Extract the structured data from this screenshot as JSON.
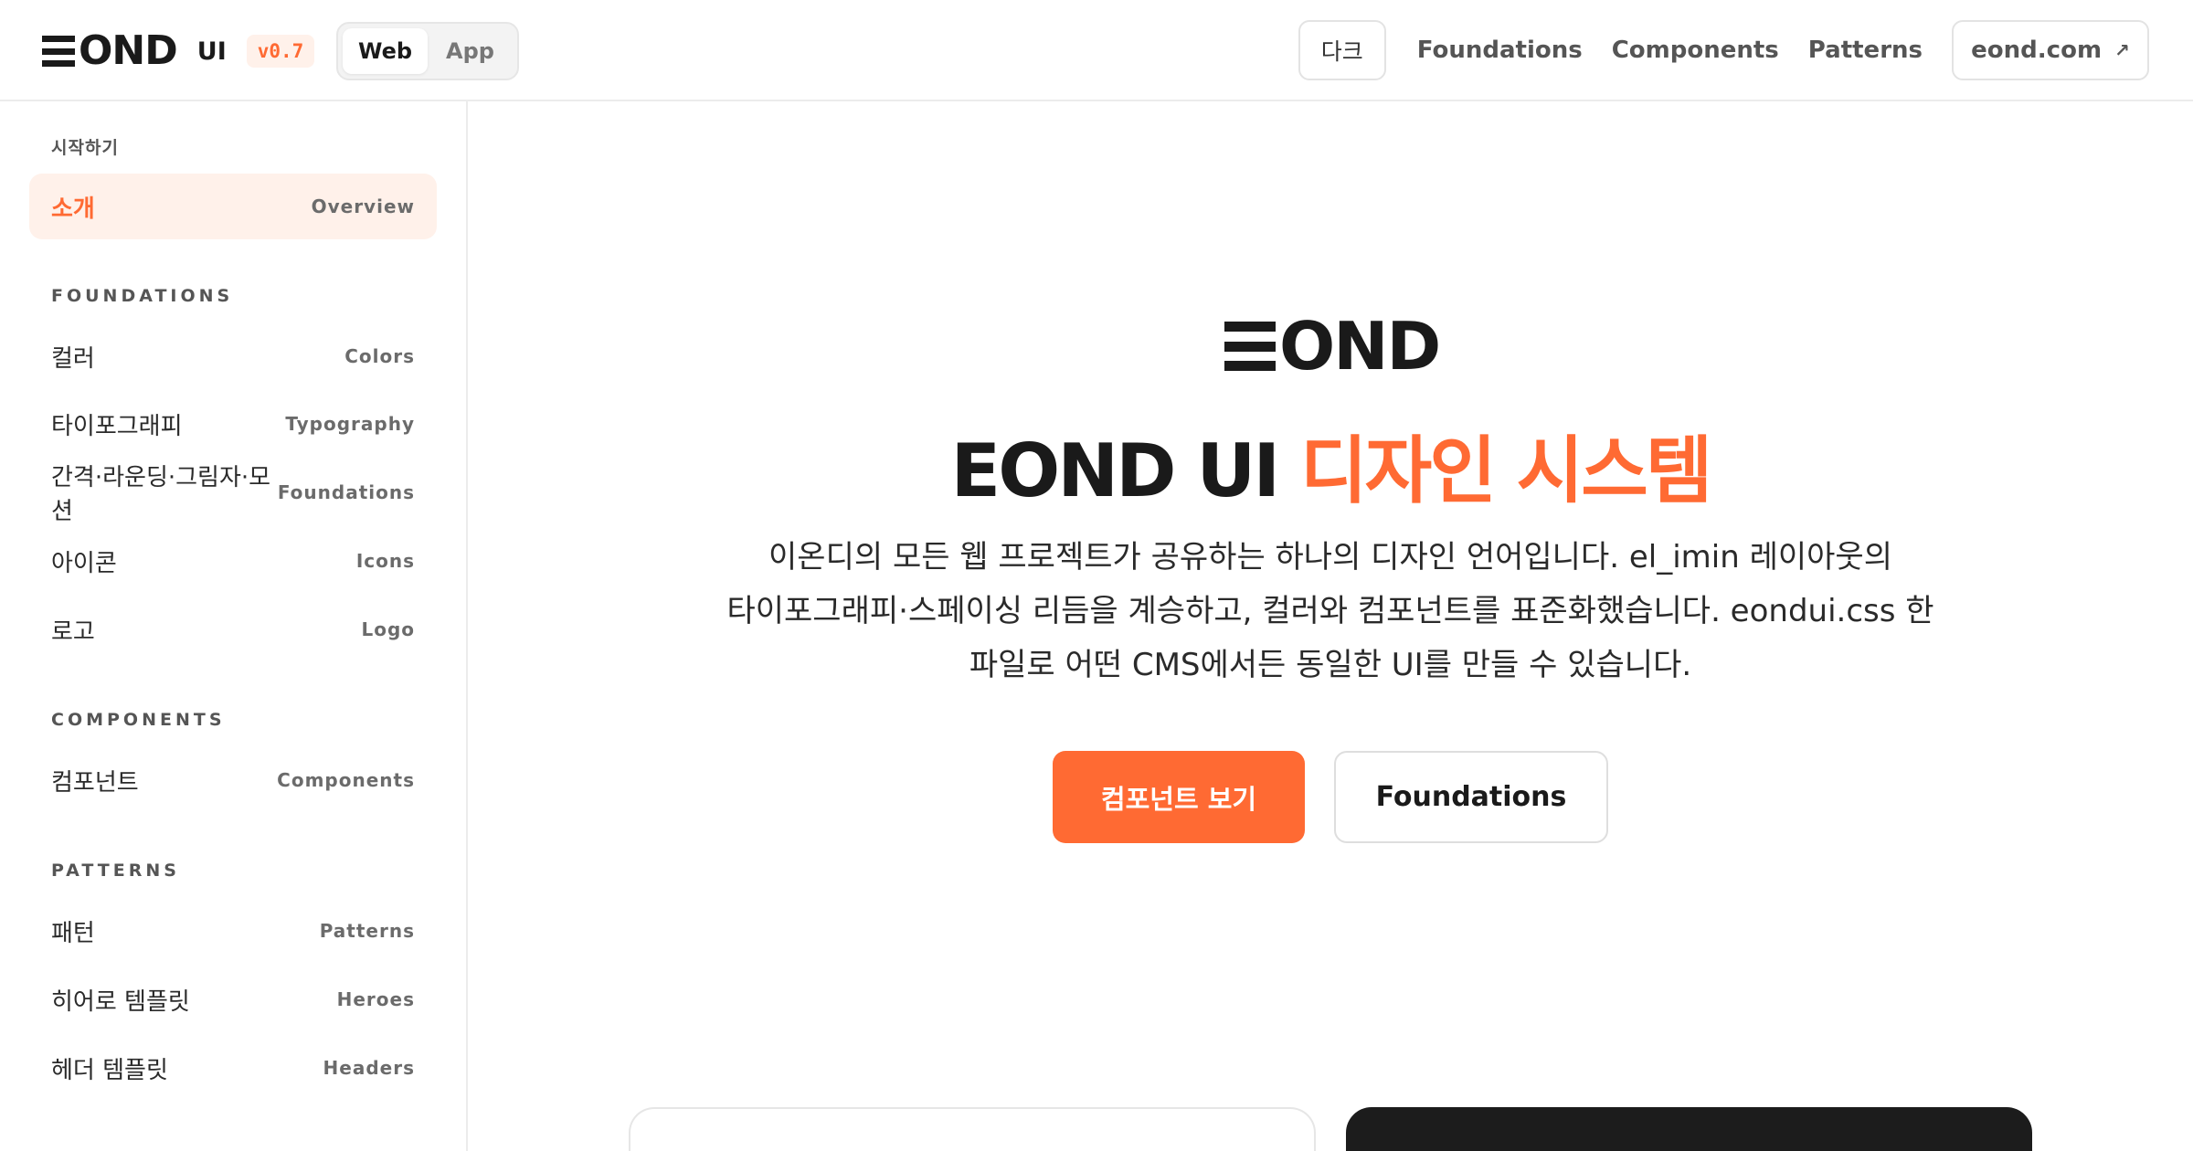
{
  "header": {
    "logo_text": "OND",
    "brand_suffix": "UI",
    "version": "v0.7",
    "platform_tabs": [
      {
        "label": "Web",
        "active": true
      },
      {
        "label": "App",
        "active": false
      }
    ],
    "theme_toggle_label": "다크",
    "nav_links": [
      "Foundations",
      "Components",
      "Patterns"
    ],
    "external_link": {
      "label": "eond.com",
      "icon": "external-arrow-icon"
    }
  },
  "sidebar": {
    "sections": [
      {
        "title": "시작하기",
        "items": [
          {
            "ko": "소개",
            "en": "Overview",
            "active": true
          }
        ]
      },
      {
        "title": "FOUNDATIONS",
        "items": [
          {
            "ko": "컬러",
            "en": "Colors"
          },
          {
            "ko": "타이포그래피",
            "en": "Typography"
          },
          {
            "ko": "간격·라운딩·그림자·모션",
            "en": "Foundations"
          },
          {
            "ko": "아이콘",
            "en": "Icons"
          },
          {
            "ko": "로고",
            "en": "Logo"
          }
        ]
      },
      {
        "title": "COMPONENTS",
        "items": [
          {
            "ko": "컴포넌트",
            "en": "Components"
          }
        ]
      },
      {
        "title": "PATTERNS",
        "items": [
          {
            "ko": "패턴",
            "en": "Patterns"
          },
          {
            "ko": "히어로 템플릿",
            "en": "Heroes"
          },
          {
            "ko": "헤더 템플릿",
            "en": "Headers"
          }
        ]
      }
    ]
  },
  "hero": {
    "logo_text": "OND",
    "title_main": "EOND UI",
    "title_accent": "디자인 시스템",
    "description": "이온디의 모든 웹 프로젝트가 공유하는 하나의 디자인 언어입니다. el_imin 레이아웃의\n타이포그래피·스페이싱 리듬을 계승하고, 컬러와 컴포넌트를 표준화했습니다. eondui.css 한\n파일로 어떤 CMS에서든 동일한 UI를 만들 수 있습니다.",
    "primary_cta": "컴포넌트 보기",
    "secondary_cta": "Foundations"
  },
  "colors": {
    "accent": "#ff6a33",
    "accent_soft": "#fff1ea",
    "text": "#1a1a1a",
    "dark_card": "#1c1c1c"
  }
}
